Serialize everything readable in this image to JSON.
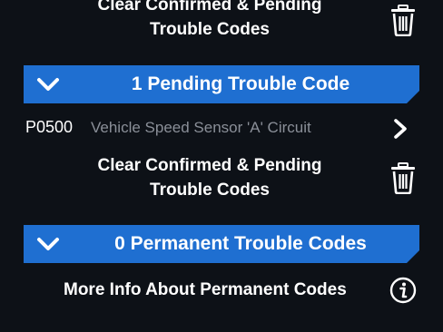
{
  "confirmed_section": {
    "clear_line1": "Clear Confirmed & Pending",
    "clear_line2": "Trouble Codes",
    "trash_icon": "trash-icon"
  },
  "pending_section": {
    "header": "1 Pending Trouble Code",
    "chevron_icon": "chevron-down-icon",
    "codes": [
      {
        "code": "P0500",
        "description": "Vehicle Speed Sensor 'A' Circuit",
        "arrow_icon": "chevron-right-icon"
      }
    ],
    "clear_line1": "Clear Confirmed & Pending",
    "clear_line2": "Trouble Codes",
    "trash_icon": "trash-icon"
  },
  "permanent_section": {
    "header": "0 Permanent Trouble Codes",
    "chevron_icon": "chevron-down-icon",
    "info_text": "More Info About Permanent Codes",
    "info_icon": "info-icon"
  },
  "colors": {
    "background": "#0d1117",
    "header_blue": "#1f6fd1",
    "description_gray": "#8a8f98",
    "text_white": "#ffffff"
  }
}
